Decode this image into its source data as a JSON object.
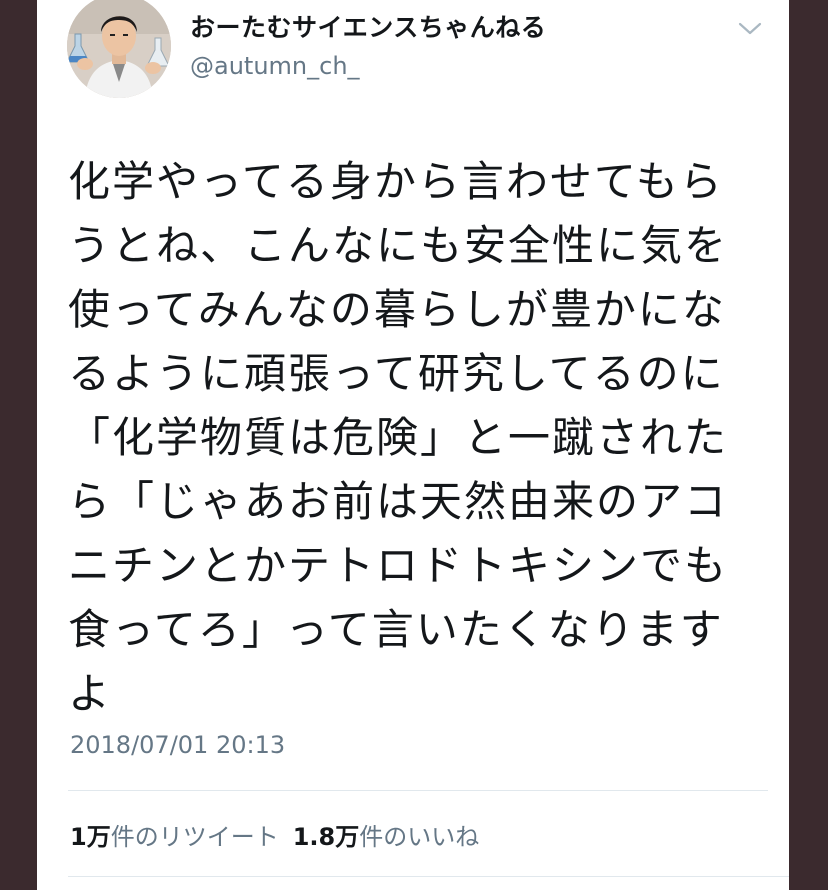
{
  "tweet": {
    "display_name": "おーたむサイエンスちゃんねる",
    "handle": "@autumn_ch_",
    "avatar_icon": "user-avatar-photo",
    "menu_icon": "chevron-down-icon",
    "text": "化学やってる身から言わせてもら\nうとね、こんなにも安全性に気を\n使ってみんなの暮らしが豊かにな\nるように頑張って研究してるのに\n「化学物質は危険」と一蹴された\nら「じゃあお前は天然由来のアコ\nニチンとかテトロドトキシンでも\n食ってろ」って言いたくなります\nよ",
    "timestamp": "2018/07/01 20:13",
    "stats": {
      "retweet_count": "1",
      "retweet_unit": "万",
      "retweet_label": "件のリツイート",
      "like_count": "1.8",
      "like_unit": "万",
      "like_label": "件のいいね"
    }
  },
  "colors": {
    "background": "#3b2a2e",
    "card": "#ffffff",
    "text_primary": "#14171a",
    "text_secondary": "#657786",
    "divider": "#e1e8ed"
  }
}
